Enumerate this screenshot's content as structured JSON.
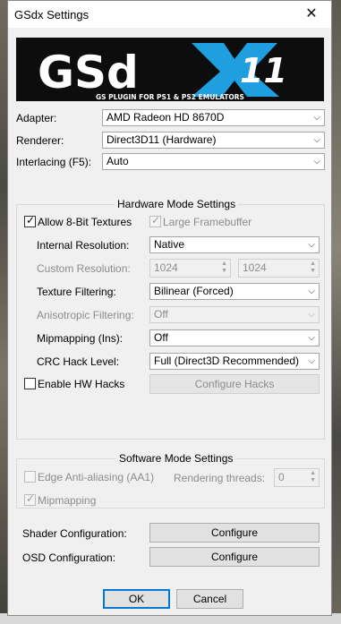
{
  "window": {
    "title": "GSdx Settings",
    "close_glyph": "✕"
  },
  "banner": {
    "brand": "GSd",
    "x_letter": "X",
    "version": "11",
    "tagline": "GS PLUGIN FOR PS1 & PS2 EMULATORS"
  },
  "top": {
    "adapter_label": "Adapter:",
    "adapter_value": "AMD Radeon HD 8670D",
    "renderer_label": "Renderer:",
    "renderer_value": "Direct3D11 (Hardware)",
    "interlacing_label": "Interlacing (F5):",
    "interlacing_value": "Auto"
  },
  "hardware": {
    "title": "Hardware Mode Settings",
    "allow8bit_label": "Allow 8-Bit Textures",
    "allow8bit_checked": true,
    "large_framebuffer_label": "Large Framebuffer",
    "large_framebuffer_checked": true,
    "internal_res_label": "Internal Resolution:",
    "internal_res_value": "Native",
    "custom_res_label": "Custom Resolution:",
    "custom_res_w": "1024",
    "custom_res_h": "1024",
    "texture_filtering_label": "Texture Filtering:",
    "texture_filtering_value": "Bilinear (Forced)",
    "aniso_label": "Anisotropic Filtering:",
    "aniso_value": "Off",
    "mipmapping_label": "Mipmapping (Ins):",
    "mipmapping_value": "Off",
    "crc_label": "CRC Hack Level:",
    "crc_value": "Full (Direct3D Recommended)",
    "hw_hacks_label": "Enable HW Hacks",
    "hw_hacks_checked": false,
    "configure_hacks_label": "Configure Hacks"
  },
  "software": {
    "title": "Software Mode Settings",
    "edge_aa_label": "Edge Anti-aliasing (AA1)",
    "edge_aa_checked": false,
    "threads_label": "Rendering threads:",
    "threads_value": "0",
    "mipmapping_label": "Mipmapping",
    "mipmapping_checked": true
  },
  "shader": {
    "label": "Shader Configuration:",
    "button": "Configure"
  },
  "osd": {
    "label": "OSD Configuration:",
    "button": "Configure"
  },
  "footer": {
    "ok_label": "OK",
    "cancel_label": "Cancel"
  },
  "glyphs": {
    "combo_arrow": "⌵",
    "check": "✓",
    "spin_up": "▲",
    "spin_down": "▼"
  },
  "colors": {
    "banner_bg": "#0d0d0d",
    "accent_blue": "#1f9fe0",
    "banner_text": "#ffffff",
    "focus_border": "#0078d7"
  }
}
